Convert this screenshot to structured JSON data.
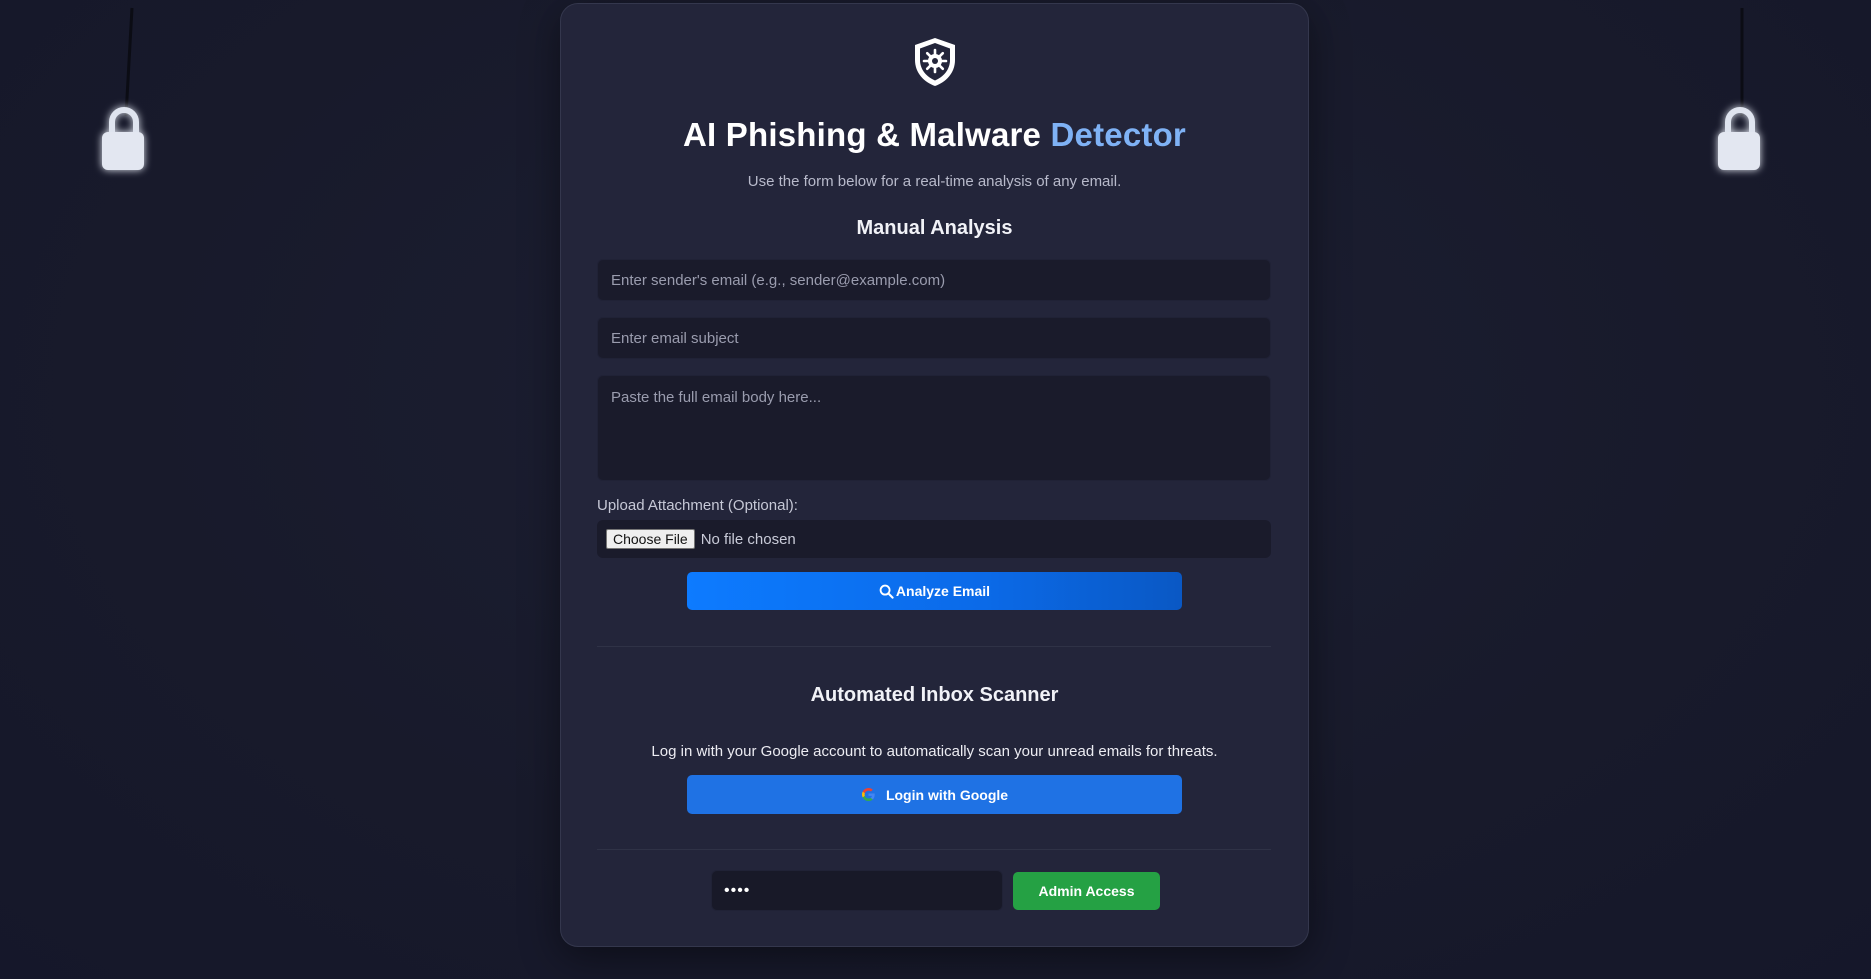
{
  "header": {
    "logo_icon": "shield-virus-icon",
    "title_main": "AI Phishing & Malware",
    "title_accent": "Detector",
    "subtitle": "Use the form below for a real-time analysis of any email."
  },
  "manual": {
    "section_title": "Manual Analysis",
    "sender_placeholder": "Enter sender's email (e.g., sender@example.com)",
    "subject_placeholder": "Enter email subject",
    "body_placeholder": "Paste the full email body here...",
    "upload_label": "Upload Attachment (Optional):",
    "choose_file_label": "Choose File",
    "file_status": "No file chosen",
    "analyze_icon": "search-icon",
    "analyze_label": "Analyze Email"
  },
  "scanner": {
    "section_title": "Automated Inbox Scanner",
    "description": "Log in with your Google account to automatically scan your unread emails for threats.",
    "google_icon": "google-icon",
    "google_label": "Login with Google"
  },
  "admin": {
    "password_value": "••••",
    "button_label": "Admin Access"
  },
  "colors": {
    "accent": "#7fb2f5",
    "primary_button": "#0d7bff",
    "google_button": "#1f72e4",
    "admin_button": "#25a144",
    "card_bg": "#23253a",
    "page_bg": "#191b2d"
  }
}
